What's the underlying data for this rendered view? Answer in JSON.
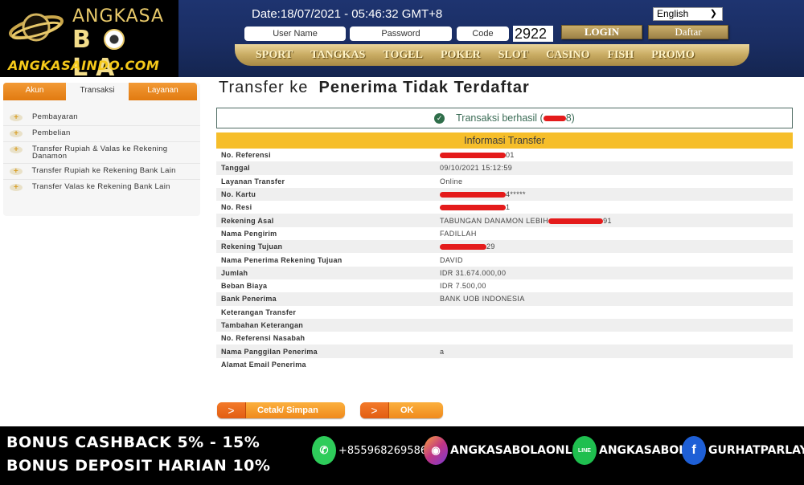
{
  "header": {
    "logo": {
      "line1": "ANGKASA",
      "line2_a": "B",
      "line2_b": "LA",
      "domain": "ANGKASAINDO.COM"
    },
    "date": "Date:18/07/2021 - 05:46:32 GMT+8",
    "language": "English",
    "username_placeholder": "User Name",
    "password_placeholder": "Password",
    "code_placeholder": "Code",
    "captcha_code": "2922",
    "login_label": "LOGIN",
    "register_label": "Daftar",
    "nav": [
      "SPORT",
      "TANGKAS",
      "TOGEL",
      "POKER",
      "SLOT",
      "CASINO",
      "FISH",
      "PROMO"
    ]
  },
  "sidebar": {
    "tabs": [
      {
        "label": "Akun",
        "active": false
      },
      {
        "label": "Transaksi",
        "active": true
      },
      {
        "label": "Layanan",
        "active": false
      }
    ],
    "items": [
      {
        "label": "Pembayaran"
      },
      {
        "label": "Pembelian"
      },
      {
        "label": "Transfer Rupiah & Valas ke Rekening Danamon"
      },
      {
        "label": "Transfer Rupiah ke Rekening Bank Lain"
      },
      {
        "label": "Transfer Valas ke Rekening Bank Lain"
      }
    ]
  },
  "main": {
    "title_prefix": "Transfer ke",
    "title_main": "Penerima Tidak Terdaftar",
    "success_text": "Transaksi berhasil (",
    "success_suffix": "8)",
    "info_header": "Informasi Transfer",
    "rows": [
      {
        "key": "No. Referensi",
        "value": "01",
        "redacted": true
      },
      {
        "key": "Tanggal",
        "value": "09/10/2021 15:12:59",
        "redacted": false
      },
      {
        "key": "Layanan Transfer",
        "value": "Online",
        "redacted": false
      },
      {
        "key": "No. Kartu",
        "value": "4*****",
        "redacted": true
      },
      {
        "key": "No. Resi",
        "value": "1",
        "redacted": true
      },
      {
        "key": "Rekening Asal",
        "value": "TABUNGAN DANAMON LEBIH",
        "suffix": "91",
        "redacted_mid": true
      },
      {
        "key": "Nama Pengirim",
        "value": "FADILLAH",
        "redacted": false
      },
      {
        "key": "Rekening Tujuan",
        "value": "29",
        "redacted": true
      },
      {
        "key": "Nama Penerima Rekening Tujuan",
        "value": "DAVID",
        "redacted": false
      },
      {
        "key": "Jumlah",
        "value": "IDR  31.674.000,00",
        "redacted": false
      },
      {
        "key": "Beban Biaya",
        "value": "IDR  7.500,00",
        "redacted": false
      },
      {
        "key": "Bank Penerima",
        "value": "BANK UOB INDONESIA",
        "redacted": false
      },
      {
        "key": "Keterangan Transfer",
        "value": "",
        "redacted": false
      },
      {
        "key": "Tambahan Keterangan",
        "value": "",
        "redacted": false
      },
      {
        "key": "No. Referensi Nasabah",
        "value": "",
        "redacted": false
      },
      {
        "key": "Nama Panggilan Penerima",
        "value": "a",
        "redacted": false
      },
      {
        "key": "Alamat Email Penerima",
        "value": "",
        "redacted": false
      }
    ],
    "print_button": "Cetak/ Simpan",
    "ok_button": "OK"
  },
  "banner": {
    "line1": "BONUS CASHBACK 5% - 15%",
    "line2": "BONUS DEPOSIT HARIAN 10%",
    "whatsapp": "+855968269586",
    "instagram": "ANGKASABOLAONLINE",
    "line": "ANGKASABOLA",
    "facebook": "GURHATPARLAY",
    "colors": {
      "whatsapp": "#2ecc5a",
      "instagram": "#c13584",
      "line": "#1fbf4f",
      "facebook": "#1e5fd6"
    }
  }
}
